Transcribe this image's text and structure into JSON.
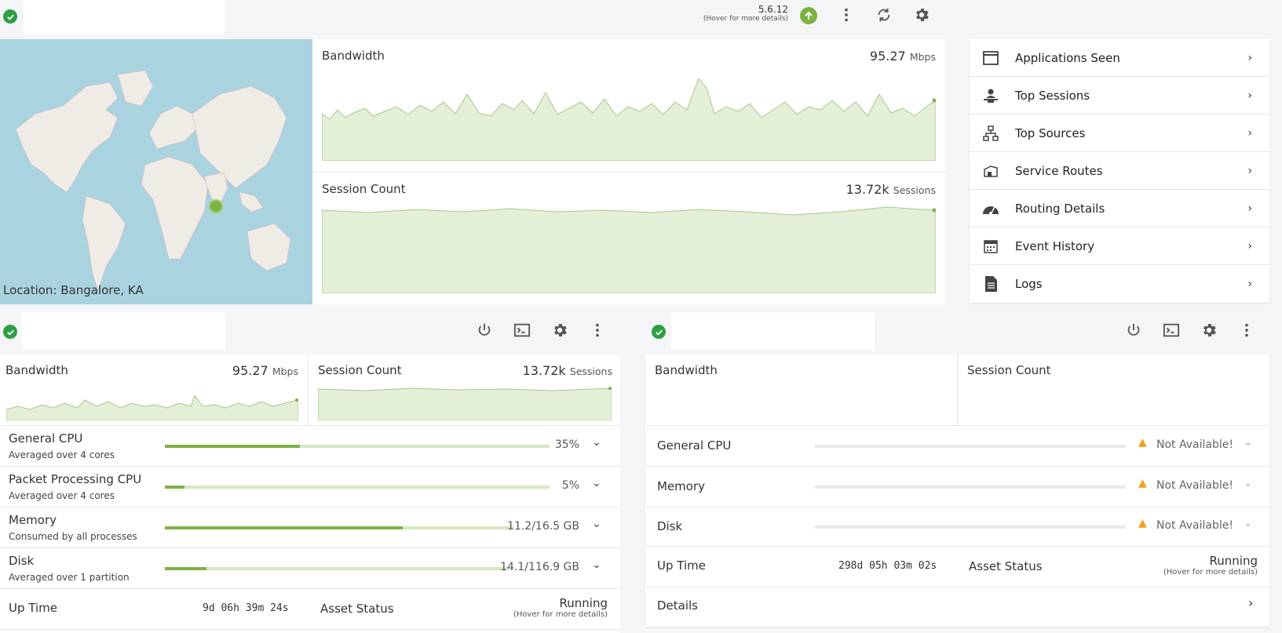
{
  "header": {
    "version": "5.6.12",
    "version_hint": "(Hover for more details)"
  },
  "map": {
    "location": "Location: Bangalore, KA"
  },
  "top_charts": {
    "bandwidth_label": "Bandwidth",
    "bandwidth_value": "95.27",
    "bandwidth_unit": "Mbps",
    "sessions_label": "Session Count",
    "sessions_value": "13.72k",
    "sessions_unit": "Sessions"
  },
  "side_menu": {
    "items": [
      {
        "label": "Applications Seen",
        "icon": "window-icon"
      },
      {
        "label": "Top Sessions",
        "icon": "user-desk-icon"
      },
      {
        "label": "Top Sources",
        "icon": "network-icon"
      },
      {
        "label": "Service Routes",
        "icon": "route-box-icon"
      },
      {
        "label": "Routing Details",
        "icon": "gauge-icon"
      },
      {
        "label": "Event History",
        "icon": "calendar-icon"
      },
      {
        "label": "Logs",
        "icon": "document-icon"
      }
    ]
  },
  "node_left": {
    "bandwidth_label": "Bandwidth",
    "bandwidth_value": "95.27",
    "bandwidth_unit": "Mbps",
    "sessions_label": "Session Count",
    "sessions_value": "13.72k",
    "sessions_unit": "Sessions",
    "metrics": [
      {
        "title": "General CPU",
        "sub": "Averaged over 4 cores",
        "value": "35%",
        "fill": 0.35
      },
      {
        "title": "Packet Processing CPU",
        "sub": "Averaged over 4 cores",
        "value": "5%",
        "fill": 0.05
      },
      {
        "title": "Memory",
        "sub": "Consumed by all processes",
        "value": "11.2/16.5 GB",
        "fill": 0.68
      },
      {
        "title": "Disk",
        "sub": "Averaged over 1 partition",
        "value": "14.1/116.9 GB",
        "fill": 0.12
      }
    ],
    "uptime_label": "Up Time",
    "uptime_value": "9d 06h 39m 24s",
    "asset_label": "Asset Status",
    "asset_value": "Running",
    "asset_hint": "(Hover for more details)"
  },
  "node_right": {
    "bandwidth_label": "Bandwidth",
    "sessions_label": "Session Count",
    "metrics": [
      {
        "title": "General CPU",
        "value": "Not Available!"
      },
      {
        "title": "Memory",
        "value": "Not Available!"
      },
      {
        "title": "Disk",
        "value": "Not Available!"
      }
    ],
    "uptime_label": "Up Time",
    "uptime_value": "298d 05h 03m 02s",
    "asset_label": "Asset Status",
    "asset_value": "Running",
    "asset_hint": "(Hover for more details)",
    "details_label": "Details"
  },
  "colors": {
    "accent_green": "#7cb342",
    "ok_green": "#2ea043",
    "warn_orange": "#f0a020",
    "chart_fill": "#e3efd6",
    "map_water": "#a9d3df"
  }
}
